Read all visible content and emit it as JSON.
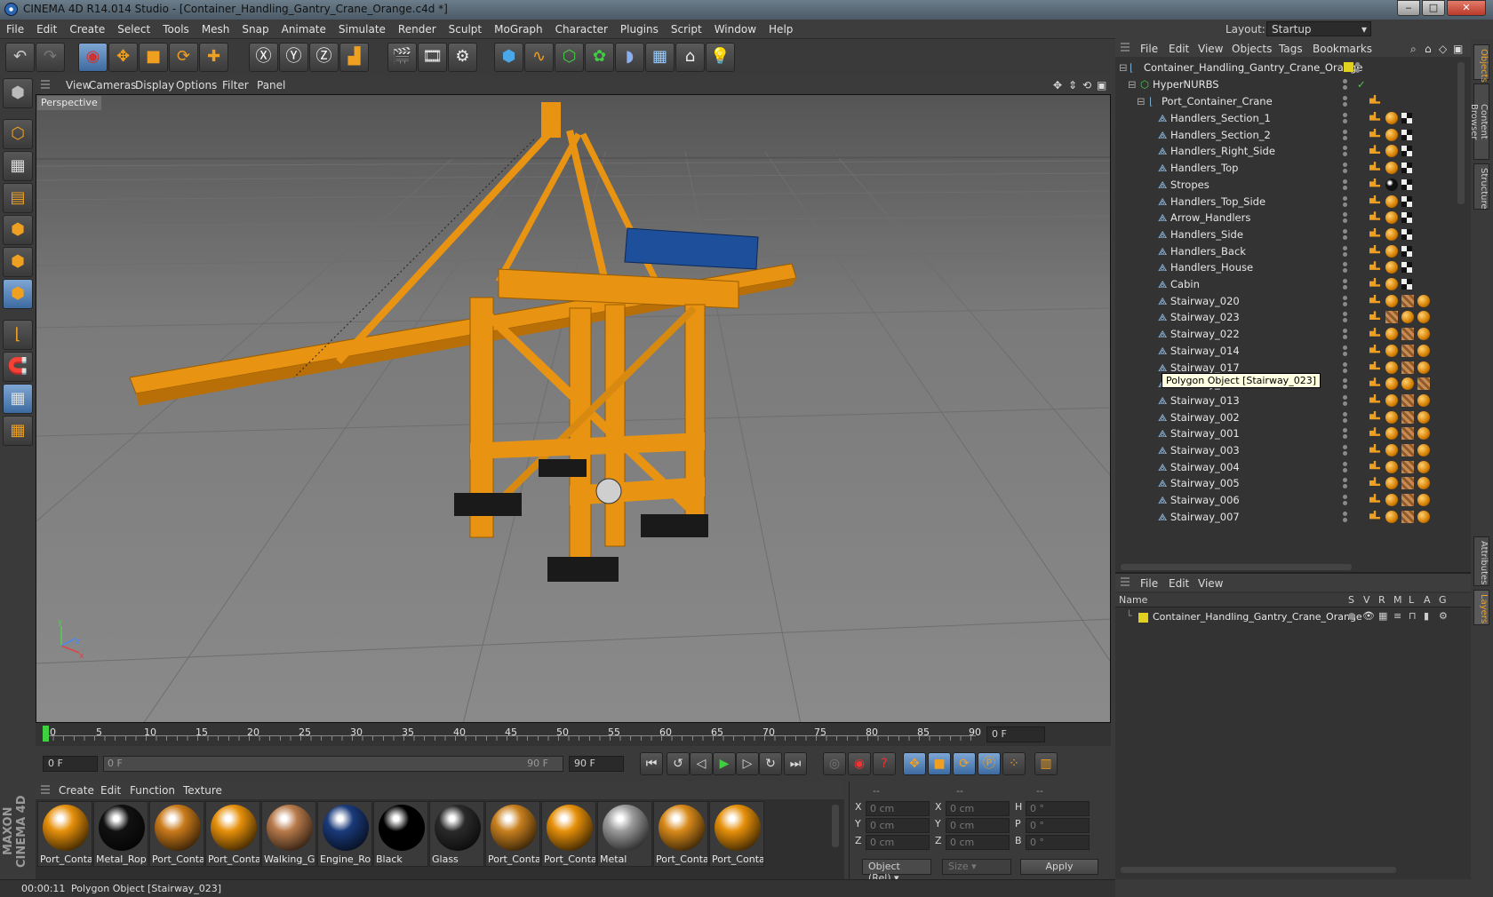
{
  "window": {
    "title": "CINEMA 4D R14.014 Studio - [Container_Handling_Gantry_Crane_Orange.c4d *]",
    "minimize": "‒",
    "maximize": "□",
    "close": "✕"
  },
  "menu": [
    "File",
    "Edit",
    "Create",
    "Select",
    "Tools",
    "Mesh",
    "Snap",
    "Animate",
    "Simulate",
    "Render",
    "Sculpt",
    "MoGraph",
    "Character",
    "Plugins",
    "Script",
    "Window",
    "Help"
  ],
  "layout": {
    "label": "Layout:",
    "value": "Startup"
  },
  "viewport": {
    "menu": [
      "View",
      "Cameras",
      "Display",
      "Options",
      "Filter",
      "Panel"
    ],
    "label": "Perspective"
  },
  "timeline": {
    "ticks": [
      "0",
      "5",
      "10",
      "15",
      "20",
      "25",
      "30",
      "35",
      "40",
      "45",
      "50",
      "55",
      "60",
      "65",
      "70",
      "75",
      "80",
      "85",
      "90"
    ],
    "current": "0 F"
  },
  "transport": {
    "start": "0 F",
    "range_start": "0 F",
    "range_end": "90 F",
    "end": "90 F"
  },
  "material_manager": {
    "menu": [
      "Create",
      "Edit",
      "Function",
      "Texture"
    ],
    "materials": [
      {
        "name": "Port_Conta",
        "color": "#e6900a"
      },
      {
        "name": "Metal_Rop",
        "color": "#111111"
      },
      {
        "name": "Port_Conta",
        "color": "#c97a1a"
      },
      {
        "name": "Port_Conta",
        "color": "#e6900a"
      },
      {
        "name": "Walking_G",
        "color": "#b87a4a"
      },
      {
        "name": "Engine_Ro",
        "color": "#1a3a7a"
      },
      {
        "name": "Black",
        "color": "#000000"
      },
      {
        "name": "Glass",
        "color": "#2a2a2a"
      },
      {
        "name": "Port_Conta",
        "color": "#c8801e"
      },
      {
        "name": "Port_Conta",
        "color": "#e6900a"
      },
      {
        "name": "Metal",
        "color": "#9a9a9a"
      },
      {
        "name": "Port_Conta",
        "color": "#d88a1a"
      },
      {
        "name": "Port_Conta",
        "color": "#e6900a"
      }
    ]
  },
  "coordinates": {
    "header": [
      "--",
      "--",
      "--"
    ],
    "rows": [
      {
        "a": "X",
        "av": "0 cm",
        "b": "X",
        "bv": "0 cm",
        "c": "H",
        "cv": "0 °"
      },
      {
        "a": "Y",
        "av": "0 cm",
        "b": "Y",
        "bv": "0 cm",
        "c": "P",
        "cv": "0 °"
      },
      {
        "a": "Z",
        "av": "0 cm",
        "b": "Z",
        "bv": "0 cm",
        "c": "B",
        "cv": "0 °"
      }
    ],
    "mode": "Object (Rel)",
    "size": "Size",
    "apply": "Apply"
  },
  "status": {
    "time": "00:00:11",
    "message": "Polygon Object [Stairway_023]"
  },
  "object_manager": {
    "menu": [
      "File",
      "Edit",
      "View",
      "Objects",
      "Tags",
      "Bookmarks"
    ],
    "root": "Container_Handling_Gantry_Crane_Orange",
    "hypernurbs": "HyperNURBS",
    "group": "Port_Container_Crane",
    "children": [
      {
        "name": "Handlers_Section_1",
        "tags": [
          "phong",
          "mat",
          "chk"
        ]
      },
      {
        "name": "Handlers_Section_2",
        "tags": [
          "phong",
          "mat",
          "chk"
        ]
      },
      {
        "name": "Handlers_Right_Side",
        "tags": [
          "phong",
          "mat",
          "chk"
        ]
      },
      {
        "name": "Handlers_Top",
        "tags": [
          "phong",
          "mat",
          "chk"
        ]
      },
      {
        "name": "Stropes",
        "tags": [
          "phong",
          "black",
          "chk"
        ]
      },
      {
        "name": "Handlers_Top_Side",
        "tags": [
          "phong",
          "mat",
          "chk"
        ]
      },
      {
        "name": "Arrow_Handlers",
        "tags": [
          "phong",
          "mat",
          "chk"
        ]
      },
      {
        "name": "Handlers_Side",
        "tags": [
          "phong",
          "mat",
          "chk"
        ]
      },
      {
        "name": "Handlers_Back",
        "tags": [
          "phong",
          "mat",
          "chk"
        ]
      },
      {
        "name": "Handlers_House",
        "tags": [
          "phong",
          "mat",
          "chk"
        ]
      },
      {
        "name": "Cabin",
        "tags": [
          "phong",
          "mat",
          "chk"
        ]
      },
      {
        "name": "Stairway_020",
        "tags": [
          "phong",
          "mat",
          "tex",
          "mat"
        ]
      },
      {
        "name": "Stairway_023",
        "tags": [
          "phong",
          "tex",
          "mat",
          "mat"
        ]
      },
      {
        "name": "Stairway_022",
        "tags": [
          "phong",
          "mat",
          "tex",
          "mat"
        ]
      },
      {
        "name": "Stairway_014",
        "tags": [
          "phong",
          "mat",
          "tex",
          "mat"
        ]
      },
      {
        "name": "Stairway_017",
        "tags": [
          "phong",
          "mat",
          "tex",
          "mat"
        ]
      },
      {
        "name": "Stairway_012",
        "tags": [
          "phong",
          "mat",
          "mat",
          "tex"
        ]
      },
      {
        "name": "Stairway_013",
        "tags": [
          "phong",
          "mat",
          "tex",
          "mat"
        ]
      },
      {
        "name": "Stairway_002",
        "tags": [
          "phong",
          "mat",
          "tex",
          "mat"
        ]
      },
      {
        "name": "Stairway_001",
        "tags": [
          "phong",
          "mat",
          "tex",
          "mat"
        ]
      },
      {
        "name": "Stairway_003",
        "tags": [
          "phong",
          "mat",
          "tex",
          "mat"
        ]
      },
      {
        "name": "Stairway_004",
        "tags": [
          "phong",
          "mat",
          "tex",
          "mat"
        ]
      },
      {
        "name": "Stairway_005",
        "tags": [
          "phong",
          "mat",
          "tex",
          "mat"
        ]
      },
      {
        "name": "Stairway_006",
        "tags": [
          "phong",
          "mat",
          "tex",
          "mat"
        ]
      },
      {
        "name": "Stairway_007",
        "tags": [
          "phong",
          "mat",
          "tex",
          "mat"
        ]
      }
    ],
    "tooltip": "Polygon Object [Stairway_023]"
  },
  "layer_manager": {
    "menu": [
      "File",
      "Edit",
      "View"
    ],
    "columns": [
      "Name",
      "S",
      "V",
      "R",
      "M",
      "L",
      "A",
      "G"
    ],
    "row": "Container_Handling_Gantry_Crane_Orange"
  },
  "right_tabs": [
    "Objects",
    "Content Browser",
    "Structure",
    "Attributes",
    "Layers"
  ],
  "brand": "MAXON CINEMA 4D"
}
